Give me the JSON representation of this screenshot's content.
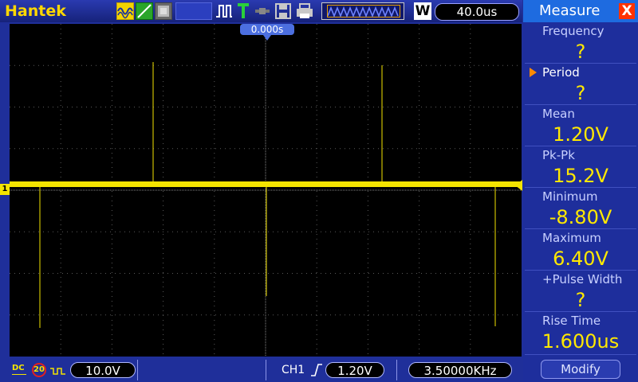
{
  "brand": "Hantek",
  "toolbar": {
    "acquire_mode": "W",
    "timebase": "40.0us",
    "icons": [
      "waveform-icon",
      "ramp-icon",
      "persistence-icon",
      "pulse-trigger-icon",
      "trigger-icon",
      "link-icon",
      "save-icon",
      "print-icon"
    ]
  },
  "screen": {
    "trigger_position": "0.000s",
    "channel_marker": "1"
  },
  "bottom": {
    "coupling": "DC",
    "bandwidth_limit": "20",
    "channel_scale": "10.0V",
    "trigger_source": "CH1",
    "trigger_level": "1.20V",
    "frequency": "3.50000KHz"
  },
  "measure": {
    "title": "Measure",
    "close_label": "X",
    "items": [
      {
        "label": "Frequency",
        "value": "?"
      },
      {
        "label": "Period",
        "value": "?",
        "selected": true
      },
      {
        "label": "Mean",
        "value": "1.20V"
      },
      {
        "label": "Pk-Pk",
        "value": "15.2V"
      },
      {
        "label": "Minimum",
        "value": "-8.80V"
      },
      {
        "label": "Maximum",
        "value": "6.40V"
      },
      {
        "label": "+Pulse Width",
        "value": "?"
      },
      {
        "label": "Rise Time",
        "value": "1.600us"
      }
    ],
    "modify_label": "Modify"
  },
  "colors": {
    "trace": "#f4e400",
    "panel": "#1e2e9c",
    "header": "#1e6be0",
    "value": "#ffe800"
  }
}
